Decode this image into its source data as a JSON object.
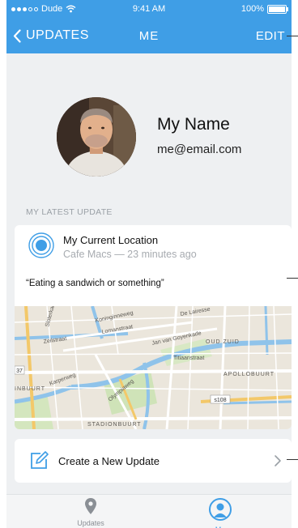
{
  "status_bar": {
    "carrier": "Dude",
    "time": "9:41 AM",
    "battery": "100%"
  },
  "nav": {
    "back_label": "UPDATES",
    "title": "ME",
    "edit_label": "EDIT"
  },
  "profile": {
    "name": "My Name",
    "email": "me@email.com"
  },
  "latest_update": {
    "section_label": "MY LATEST UPDATE",
    "location_title": "My Current Location",
    "location_subtitle": "Cafe Macs — 23 minutes ago",
    "text": "“Eating a sandwich or something”",
    "map_labels": [
      "Koninginneweg",
      "De Lairesse",
      "Zeilstraat",
      "Lomanstraat",
      "Jan van Goyenkade",
      "OUD ZUID",
      "Titiaanstraat",
      "APOLLOBUURT",
      "Karperweg",
      "Olympiaweg",
      "INBUURT",
      "STADIONBUURT",
      "s108",
      "37",
      "Sloterkade"
    ]
  },
  "create_update": {
    "label": "Create a New Update"
  },
  "tab_bar": {
    "tabs": [
      {
        "label": "Updates",
        "icon": "map-pin-icon"
      },
      {
        "label": "Me",
        "icon": "person-icon"
      }
    ]
  },
  "colors": {
    "accent": "#3f9ee6",
    "background": "#eef0f2"
  }
}
